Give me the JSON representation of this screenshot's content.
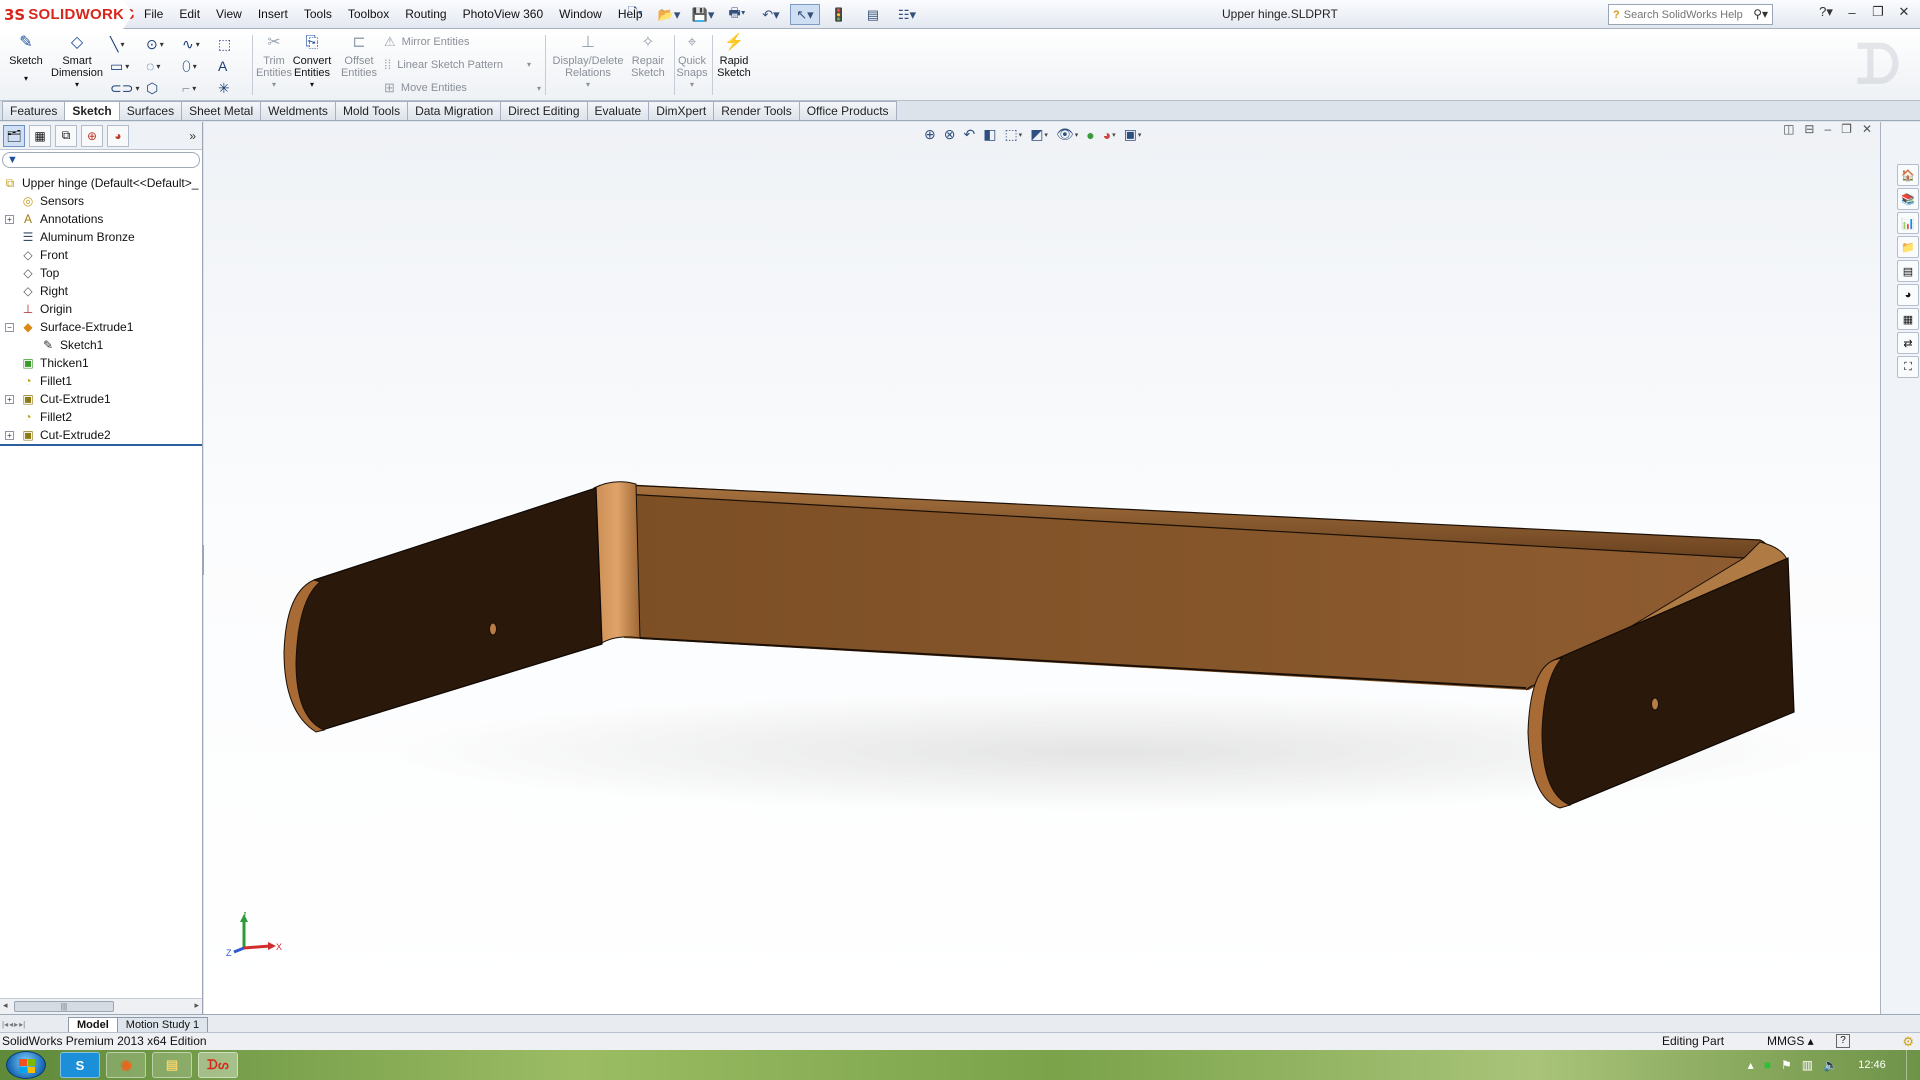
{
  "app": {
    "logo_ds": "3S",
    "logo_text": "SOLIDWORKS",
    "document_title": "Upper hinge.SLDPRT"
  },
  "menu": [
    "File",
    "Edit",
    "View",
    "Insert",
    "Tools",
    "Toolbox",
    "Routing",
    "PhotoView 360",
    "Window",
    "Help"
  ],
  "search": {
    "placeholder": "Search SolidWorks Help"
  },
  "ribbon": {
    "sketch": "Sketch",
    "smart_dimension_1": "Smart",
    "smart_dimension_2": "Dimension",
    "trim_1": "Trim",
    "trim_2": "Entities",
    "convert_1": "Convert",
    "convert_2": "Entities",
    "offset_1": "Offset",
    "offset_2": "Entities",
    "mirror": "Mirror Entities",
    "linear_pattern": "Linear Sketch Pattern",
    "move": "Move Entities",
    "display_delete_1": "Display/Delete",
    "display_delete_2": "Relations",
    "repair_1": "Repair",
    "repair_2": "Sketch",
    "quick_snaps_1": "Quick",
    "quick_snaps_2": "Snaps",
    "rapid_sketch_1": "Rapid",
    "rapid_sketch_2": "Sketch"
  },
  "tabs": [
    "Features",
    "Sketch",
    "Surfaces",
    "Sheet Metal",
    "Weldments",
    "Mold Tools",
    "Data Migration",
    "Direct Editing",
    "Evaluate",
    "DimXpert",
    "Render Tools",
    "Office Products"
  ],
  "active_tab": "Sketch",
  "feature_tree": {
    "root": "Upper hinge  (Default<<Default>_",
    "items": [
      {
        "label": "Sensors",
        "icon": "sensors-icon",
        "expandable": false
      },
      {
        "label": "Annotations",
        "icon": "annotations-icon",
        "expandable": true
      },
      {
        "label": "Aluminum Bronze",
        "icon": "material-icon",
        "expandable": false
      },
      {
        "label": "Front",
        "icon": "plane-icon",
        "expandable": false
      },
      {
        "label": "Top",
        "icon": "plane-icon",
        "expandable": false
      },
      {
        "label": "Right",
        "icon": "plane-icon",
        "expandable": false
      },
      {
        "label": "Origin",
        "icon": "origin-icon",
        "expandable": false
      },
      {
        "label": "Surface-Extrude1",
        "icon": "surface-extrude-icon",
        "expandable": true,
        "expanded": true
      },
      {
        "label": "Sketch1",
        "icon": "sketch-icon",
        "expandable": false,
        "child": true
      },
      {
        "label": "Thicken1",
        "icon": "thicken-icon",
        "expandable": false
      },
      {
        "label": "Fillet1",
        "icon": "fillet-icon",
        "expandable": false
      },
      {
        "label": "Cut-Extrude1",
        "icon": "cut-extrude-icon",
        "expandable": true
      },
      {
        "label": "Fillet2",
        "icon": "fillet-icon",
        "expandable": false
      },
      {
        "label": "Cut-Extrude2",
        "icon": "cut-extrude-icon",
        "expandable": true
      }
    ]
  },
  "triad": {
    "x": "X",
    "y": "Y",
    "z": "Z"
  },
  "bottom_tabs": [
    "Model",
    "Motion Study 1"
  ],
  "status": {
    "edition": "SolidWorks Premium 2013 x64 Edition",
    "editing": "Editing Part",
    "units": "MMGS",
    "help": "?"
  },
  "taskbar": {
    "clock": "12:46",
    "apps": [
      "skype",
      "firefox",
      "explorer",
      "solidworks"
    ],
    "skype_label": "S"
  },
  "colors": {
    "brand_red": "#d9261c",
    "part_bronze": "#8a5a30",
    "part_dark": "#2b1a0d",
    "accent_blue": "#2c5d9e"
  }
}
